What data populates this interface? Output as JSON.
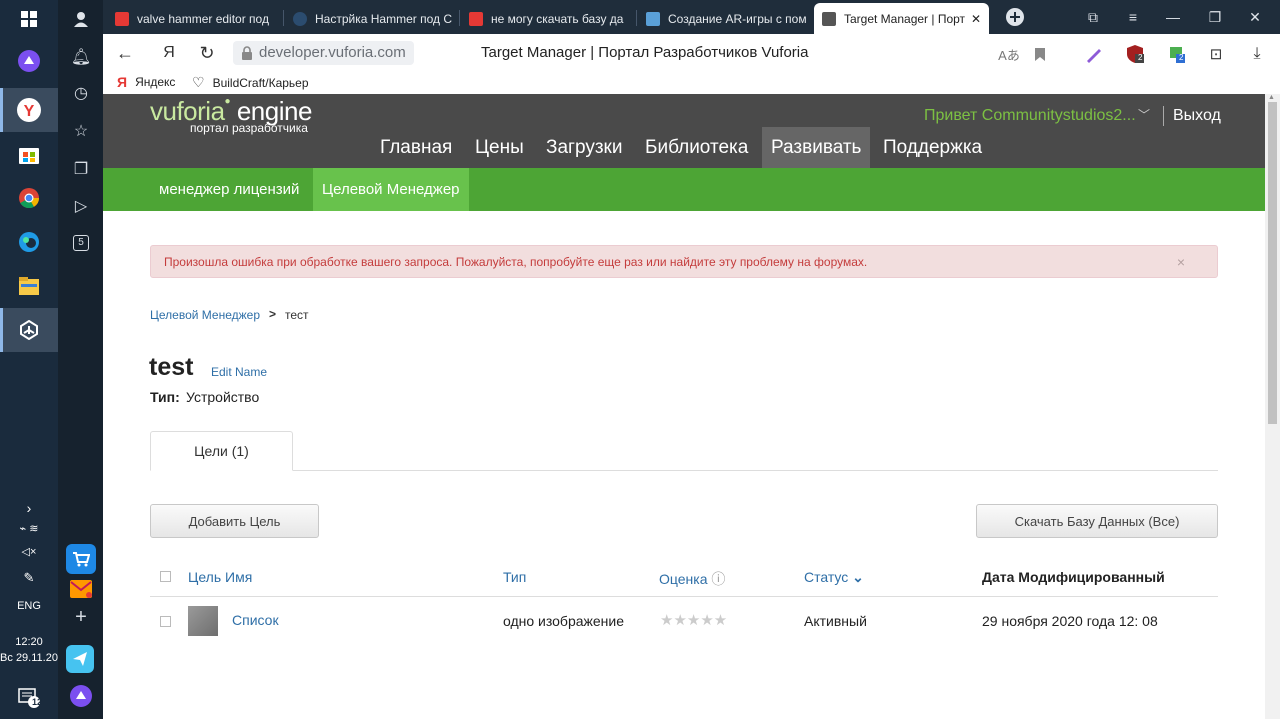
{
  "taskbar": {
    "time": "12:20",
    "date": "Вс 29.11.20",
    "lang": "ENG",
    "notif_count": "12"
  },
  "sidepanel": {
    "badge": "5"
  },
  "tabs": [
    {
      "label": "valve hammer editor под",
      "fav_color": "#e53935"
    },
    {
      "label": "Настрйка Hammer под С",
      "fav_color": "#2b4c6f"
    },
    {
      "label": "не могу скачать базу да",
      "fav_color": "#e53935"
    },
    {
      "label": "Создание AR-игры с пом",
      "fav_color": "#5aa0d8"
    },
    {
      "label": "Target Manager | Порт",
      "fav_color": "#555"
    }
  ],
  "address": {
    "url": "developer.vuforia.com",
    "page_title": "Target Manager | Портал Разработчиков Vuforia",
    "ext_badge_1": "2",
    "ext_badge_2": "2"
  },
  "bookmarks": [
    {
      "label": "Яндекс"
    },
    {
      "label": "BuildCraft/Карьер"
    }
  ],
  "header": {
    "logo_vuforia": "vuforia",
    "logo_engine": "engine",
    "logo_sub": "портал разработчика",
    "greeting": "Привет Communitystudios2...",
    "logout": "Выход",
    "nav": [
      "Главная",
      "Цены",
      "Загрузки",
      "Библиотека",
      "Развивать",
      "Поддержка"
    ],
    "active_nav": "Развивать"
  },
  "subnav": {
    "items": [
      "менеджер лицензий",
      "Целевой Менеджер"
    ],
    "active": "Целевой Менеджер"
  },
  "alert": {
    "text": "Произошла ошибка при обработке вашего запроса. Пожалуйста, попробуйте еще раз или найдите эту проблему на форумах.",
    "close": "×"
  },
  "breadcrumb": {
    "parent": "Целевой Менеджер",
    "sep": ">",
    "current": "тест"
  },
  "database": {
    "name": "test",
    "edit_link": "Edit Name",
    "type_label": "Тип:",
    "type_value": "Устройство"
  },
  "page_tabs": {
    "targets": "Цели (1)"
  },
  "buttons": {
    "add_target": "Добавить Цель",
    "download_db": "Скачать Базу Данных (Все)"
  },
  "table": {
    "headers": {
      "name": "Цель Имя",
      "type": "Тип",
      "rating": "Оценка",
      "rating_icon": "ⓘ",
      "status": "Статус",
      "status_caret": "⌄",
      "modified": "Дата Модифицированный"
    },
    "rows": [
      {
        "name": "Список",
        "type": "одно изображение",
        "rating_stars": "★★★★★",
        "rating_value": 0,
        "status": "Активный",
        "modified": "29 ноября 2020 года 12: 08"
      }
    ]
  }
}
